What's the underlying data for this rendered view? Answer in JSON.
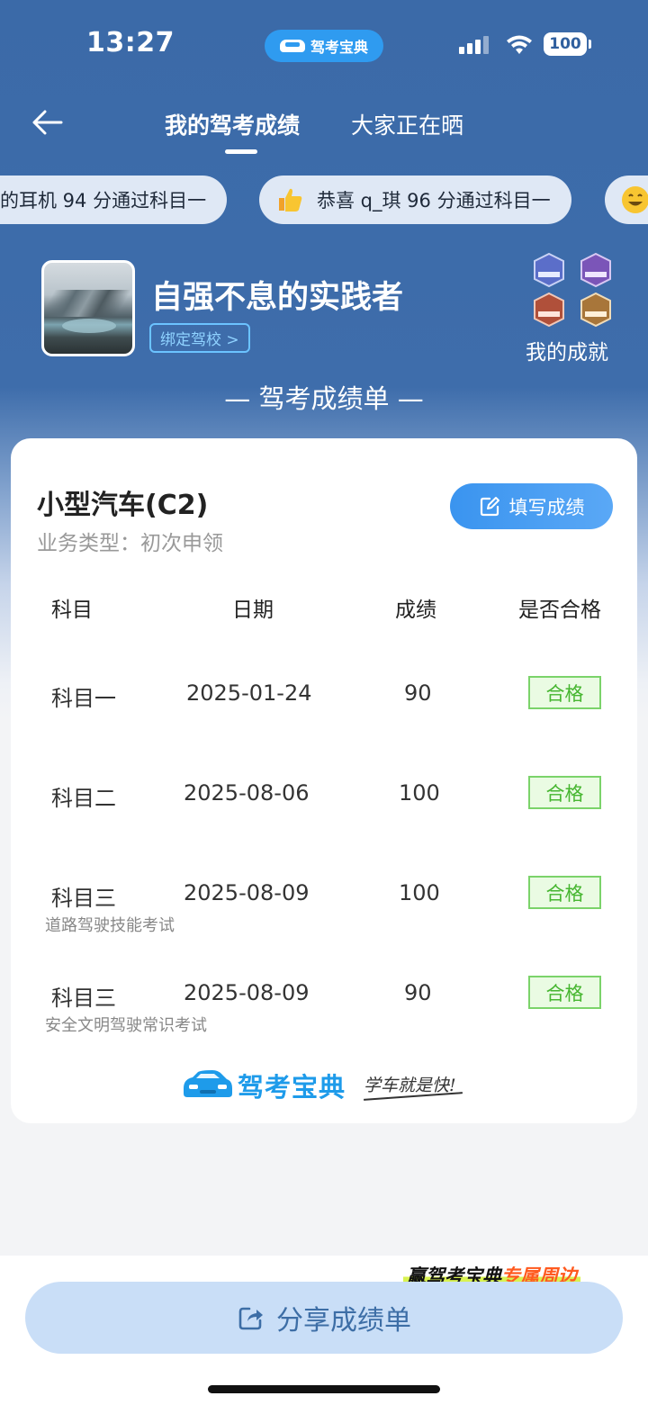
{
  "status_bar": {
    "time": "13:27",
    "app_pill_label": "驾考宝典",
    "battery": "100"
  },
  "nav": {
    "tabs": [
      {
        "label": "我的驾考成绩",
        "active": true
      },
      {
        "label": "大家正在晒",
        "active": false
      }
    ]
  },
  "ticker": [
    {
      "text": "的耳机 94 分通过科目一",
      "icon": ""
    },
    {
      "text": "恭喜 q_琪 96 分通过科目一",
      "icon": "thumbs-up-icon"
    },
    {
      "text": "",
      "icon": "smile-icon"
    }
  ],
  "profile": {
    "username": "自强不息的实践者",
    "bind_school": "绑定驾校 >",
    "achievements_label": "我的成就"
  },
  "sheet_title": "— 驾考成绩单 —",
  "card": {
    "car_type": "小型汽车(C2)",
    "business_type": "业务类型：初次申领",
    "fill_button": "填写成绩",
    "headers": [
      "科目",
      "日期",
      "成绩",
      "是否合格"
    ],
    "rows": [
      {
        "subject": "科目一",
        "date": "2025-01-24",
        "score": "90",
        "result": "合格",
        "note": ""
      },
      {
        "subject": "科目二",
        "date": "2025-08-06",
        "score": "100",
        "result": "合格",
        "note": ""
      },
      {
        "subject": "科目三",
        "date": "2025-08-09",
        "score": "100",
        "result": "合格",
        "note": "道路驾驶技能考试"
      },
      {
        "subject": "科目三",
        "date": "2025-08-09",
        "score": "90",
        "result": "合格",
        "note": "安全文明驾驶常识考试"
      }
    ],
    "brand_name": "驾考宝典",
    "brand_slogan": "学车就是快!"
  },
  "promo": {
    "prefix": "赢驾考宝典",
    "accent": "专属周边"
  },
  "share_button": "分享成绩单",
  "colors": {
    "header_blue": "#3b6aa8",
    "accent_blue": "#3a94ef",
    "pass_green": "#46b630",
    "share_bg": "#c9def7"
  }
}
